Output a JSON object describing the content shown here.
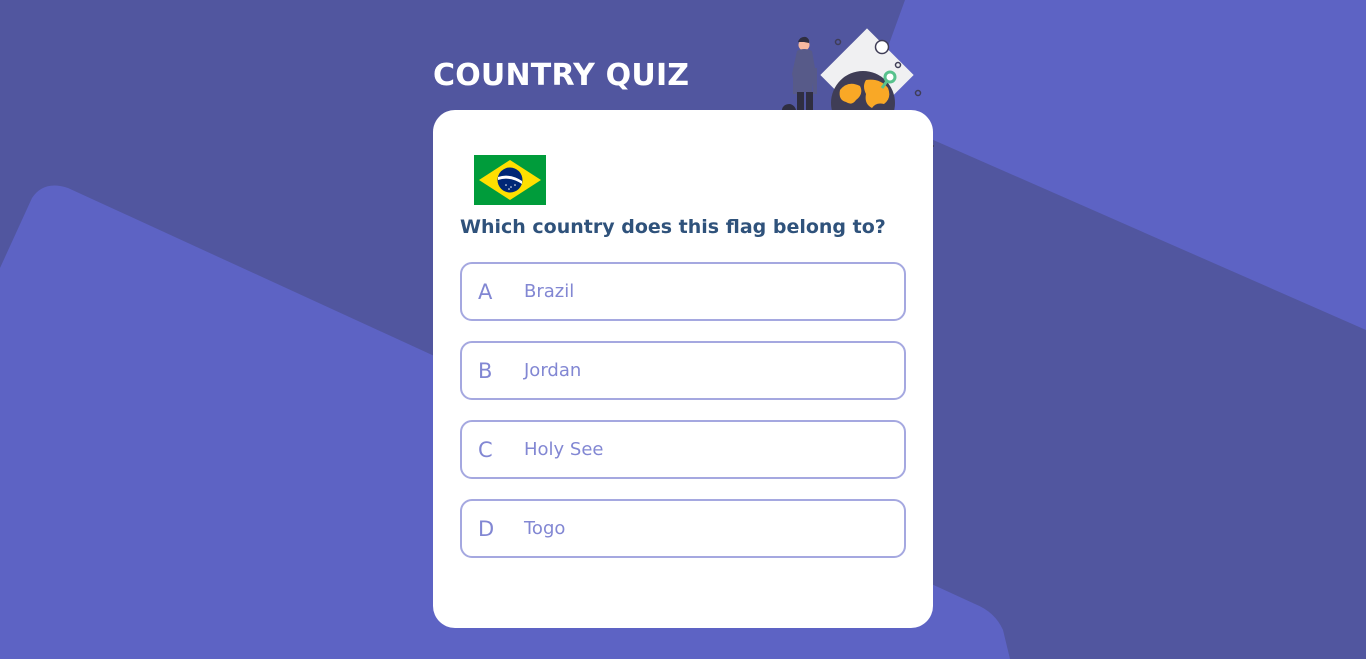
{
  "app": {
    "title": "COUNTRY QUIZ"
  },
  "question": {
    "flag_country": "Brazil",
    "text": "Which country does this flag belong to?"
  },
  "answers": [
    {
      "letter": "A",
      "text": "Brazil"
    },
    {
      "letter": "B",
      "text": "Jordan"
    },
    {
      "letter": "C",
      "text": "Holy See"
    },
    {
      "letter": "D",
      "text": "Togo"
    }
  ],
  "icons": {
    "illustration": "traveler-globe-illustration",
    "flag": "brazil-flag-icon"
  },
  "colors": {
    "background": "#5d63c4",
    "background_band": "#51569f",
    "card": "#ffffff",
    "question_text": "#2f527b",
    "answer_border": "#a5a8e0",
    "answer_text": "#8287d3",
    "globe_accent": "#f9a826"
  }
}
